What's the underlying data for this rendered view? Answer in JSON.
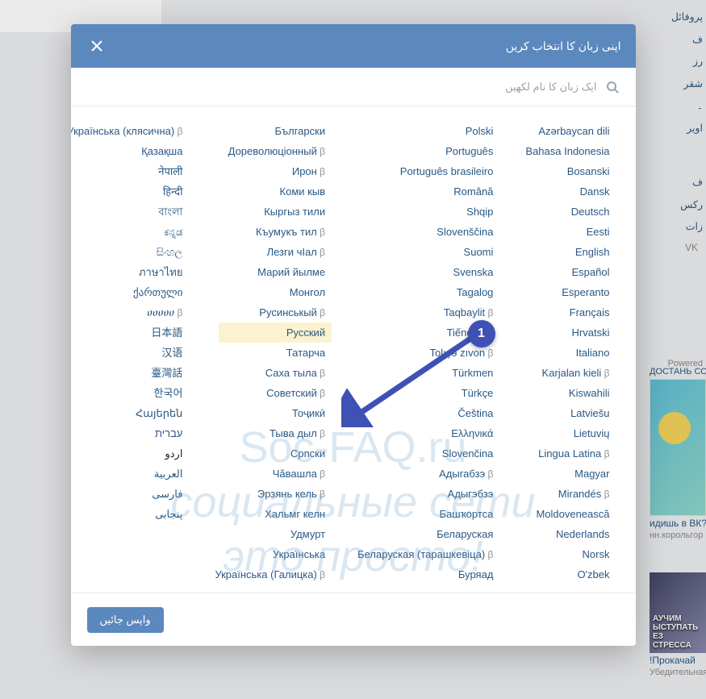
{
  "modal": {
    "title": "اپنی زبان کا انتخاب کریں",
    "search_placeholder": "ایک زبان کا نام لکھیں",
    "back_label": "واپس جائیں"
  },
  "annotation": {
    "badge": "1"
  },
  "watermark": {
    "line1": "Soc-FAQ.ru",
    "line2": "социальные сети",
    "line3": "это просто!"
  },
  "columns": [
    [
      {
        "label": "Azərbaycan dili"
      },
      {
        "label": "Bahasa Indonesia"
      },
      {
        "label": "Bosanski"
      },
      {
        "label": "Dansk"
      },
      {
        "label": "Deutsch"
      },
      {
        "label": "Eesti"
      },
      {
        "label": "English"
      },
      {
        "label": "Español"
      },
      {
        "label": "Esperanto"
      },
      {
        "label": "Français"
      },
      {
        "label": "Hrvatski"
      },
      {
        "label": "Italiano"
      },
      {
        "label": "Karjalan kieli",
        "beta": true
      },
      {
        "label": "Kiswahili"
      },
      {
        "label": "Latviešu"
      },
      {
        "label": "Lietuvių"
      },
      {
        "label": "Lingua Latina",
        "beta": true
      },
      {
        "label": "Magyar"
      },
      {
        "label": "Mirandés",
        "beta": true
      },
      {
        "label": "Moldovenească"
      },
      {
        "label": "Nederlands"
      },
      {
        "label": "Norsk"
      },
      {
        "label": "O'zbek"
      }
    ],
    [
      {
        "label": "Polski"
      },
      {
        "label": "Português"
      },
      {
        "label": "Português brasileiro"
      },
      {
        "label": "Română"
      },
      {
        "label": "Shqip"
      },
      {
        "label": "Slovenščina"
      },
      {
        "label": "Suomi"
      },
      {
        "label": "Svenska"
      },
      {
        "label": "Tagalog"
      },
      {
        "label": "Taqbaylit",
        "beta": true
      },
      {
        "label": "Tiếng Việt"
      },
      {
        "label": "Tolışə zıvon",
        "beta": true
      },
      {
        "label": "Türkmen"
      },
      {
        "label": "Türkçe"
      },
      {
        "label": "Čeština"
      },
      {
        "label": "Ελληνικά"
      },
      {
        "label": "Slovenčina"
      },
      {
        "label": "Адыгабзэ",
        "beta": true
      },
      {
        "label": "Адыгэбзэ"
      },
      {
        "label": "Башҡортса"
      },
      {
        "label": "Беларуская"
      },
      {
        "label": "Беларуская (тарашкевіца)",
        "beta": true
      },
      {
        "label": "Буряад"
      }
    ],
    [
      {
        "label": "Български"
      },
      {
        "label": "Дореволюціонный",
        "beta": true
      },
      {
        "label": "Ирон",
        "beta": true
      },
      {
        "label": "Коми кыв"
      },
      {
        "label": "Кыргыз тили"
      },
      {
        "label": "Къумукъ тил",
        "beta": true
      },
      {
        "label": "Лезги чІал",
        "beta": true
      },
      {
        "label": "Марий йылме"
      },
      {
        "label": "Монгол"
      },
      {
        "label": "Русинськый",
        "beta": true
      },
      {
        "label": "Русский",
        "highlight": true
      },
      {
        "label": "Татарча"
      },
      {
        "label": "Саха тыла",
        "beta": true
      },
      {
        "label": "Советский",
        "beta": true
      },
      {
        "label": "Тоҷикӣ"
      },
      {
        "label": "Тыва дыл",
        "beta": true
      },
      {
        "label": "Српски"
      },
      {
        "label": "Чӑвашла",
        "beta": true
      },
      {
        "label": "Эрзянь кель",
        "beta": true
      },
      {
        "label": "Хальмг келн"
      },
      {
        "label": "Удмурт"
      },
      {
        "label": "Українська"
      },
      {
        "label": "Українська (Галицка)",
        "beta": true
      }
    ],
    [
      {
        "label": "Українська (клясична)",
        "beta": true
      },
      {
        "label": "Қазақша"
      },
      {
        "label": "नेपाली"
      },
      {
        "label": "हिन्दी"
      },
      {
        "label": "বাংলা"
      },
      {
        "label": "ಕನ್ನಡ"
      },
      {
        "label": "සිංහල"
      },
      {
        "label": "ภาษาไทย"
      },
      {
        "label": "ქართული"
      },
      {
        "label": "ሀሀሀሀሀ",
        "beta": true
      },
      {
        "label": "日本語"
      },
      {
        "label": "汉语"
      },
      {
        "label": "臺灣話"
      },
      {
        "label": "한국어"
      },
      {
        "label": "Հայերեն"
      },
      {
        "label": "עברית"
      },
      {
        "label": "اردو",
        "current": true
      },
      {
        "label": "العربية"
      },
      {
        "label": "فارسی"
      },
      {
        "label": "پنجابی"
      }
    ]
  ],
  "bg_nav": [
    "پروفائل",
    "ف",
    "رز",
    "شقر",
    "۔",
    "اویر",
    "ف",
    "رکس",
    "زات"
  ],
  "bg_vk": "VK",
  "bg_powered": "Powered ",
  "bg_dostan": "ДОСТАНЬ СОКРО",
  "bg_ad1_title": "идишь в ВК? П",
  "bg_ad1_sub": "нн.корольгор",
  "bg_ad2_inner": "АУЧИМ\nЫСТУПАТЬ\nЕЗ СТРЕССА",
  "bg_ad2_title": "!Прокачай",
  "bg_ad2_sub": "Убедительная, с"
}
